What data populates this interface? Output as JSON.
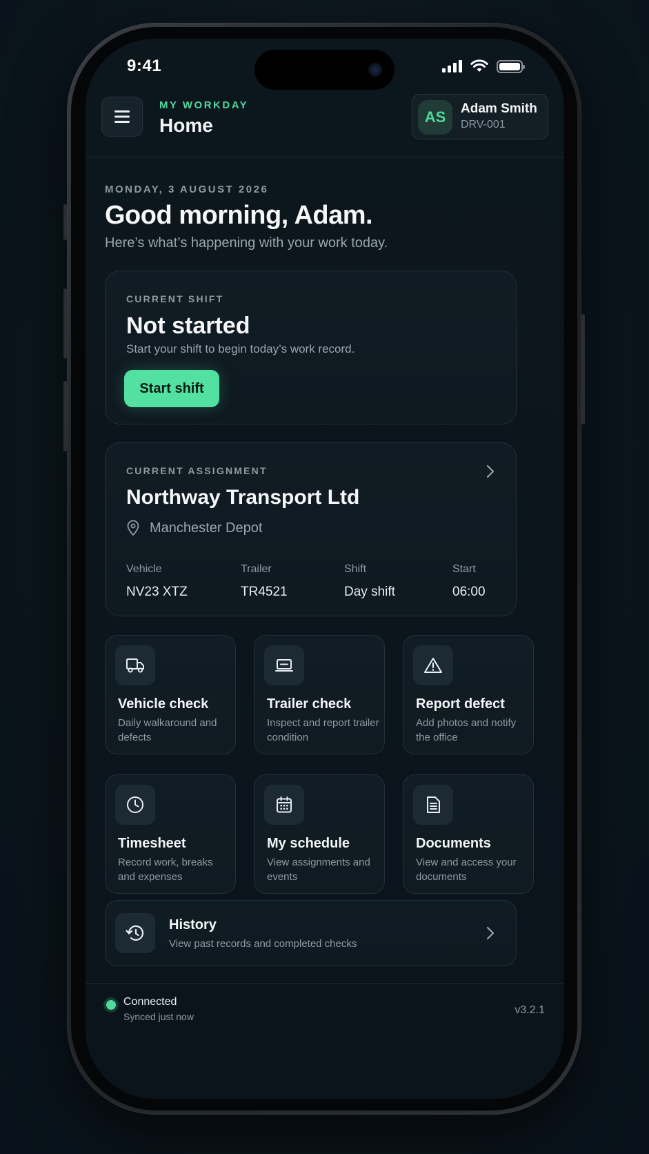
{
  "status_bar": {
    "time": "9:41"
  },
  "header": {
    "eyebrow": "MY WORKDAY",
    "title": "Home",
    "profile": {
      "initials": "AS",
      "name": "Adam Smith",
      "id": "DRV-001"
    }
  },
  "greeting": {
    "date": "MONDAY, 3 AUGUST 2026",
    "title": "Good morning, Adam.",
    "subtitle": "Here’s what’s happening with your work today."
  },
  "current_shift": {
    "eyebrow": "CURRENT SHIFT",
    "status": "Not started",
    "description": "Start your shift to begin today’s work record.",
    "button_label": "Start shift"
  },
  "current_assignment": {
    "eyebrow": "CURRENT ASSIGNMENT",
    "company": "Northway Transport Ltd",
    "location": "Manchester Depot",
    "details": [
      {
        "label": "Vehicle",
        "value": "NV23 XTZ"
      },
      {
        "label": "Trailer",
        "value": "TR4521"
      },
      {
        "label": "Shift",
        "value": "Day shift"
      },
      {
        "label": "Start",
        "value": "06:00"
      }
    ]
  },
  "actions": [
    {
      "title": "Vehicle check",
      "description": "Daily walkaround and defects",
      "icon": "truck-icon"
    },
    {
      "title": "Trailer check",
      "description": "Inspect and report trailer condition",
      "icon": "trailer-icon"
    },
    {
      "title": "Report defect",
      "description": "Add photos and notify the office",
      "icon": "warning-icon"
    },
    {
      "title": "Timesheet",
      "description": "Record work, breaks and expenses",
      "icon": "clock-icon"
    },
    {
      "title": "My schedule",
      "description": "View assignments and events",
      "icon": "calendar-icon"
    },
    {
      "title": "Documents",
      "description": "View and access your documents",
      "icon": "document-icon"
    }
  ],
  "history": {
    "title": "History",
    "description": "View past records and completed checks",
    "icon": "history-icon"
  },
  "footer": {
    "connection": "Connected",
    "sync_status": "Synced just now",
    "version": "v3.2.1"
  },
  "colors": {
    "accent": "#4fd99a",
    "button": "#52e1a0",
    "background": "#0c161d",
    "card": "#101c23"
  }
}
